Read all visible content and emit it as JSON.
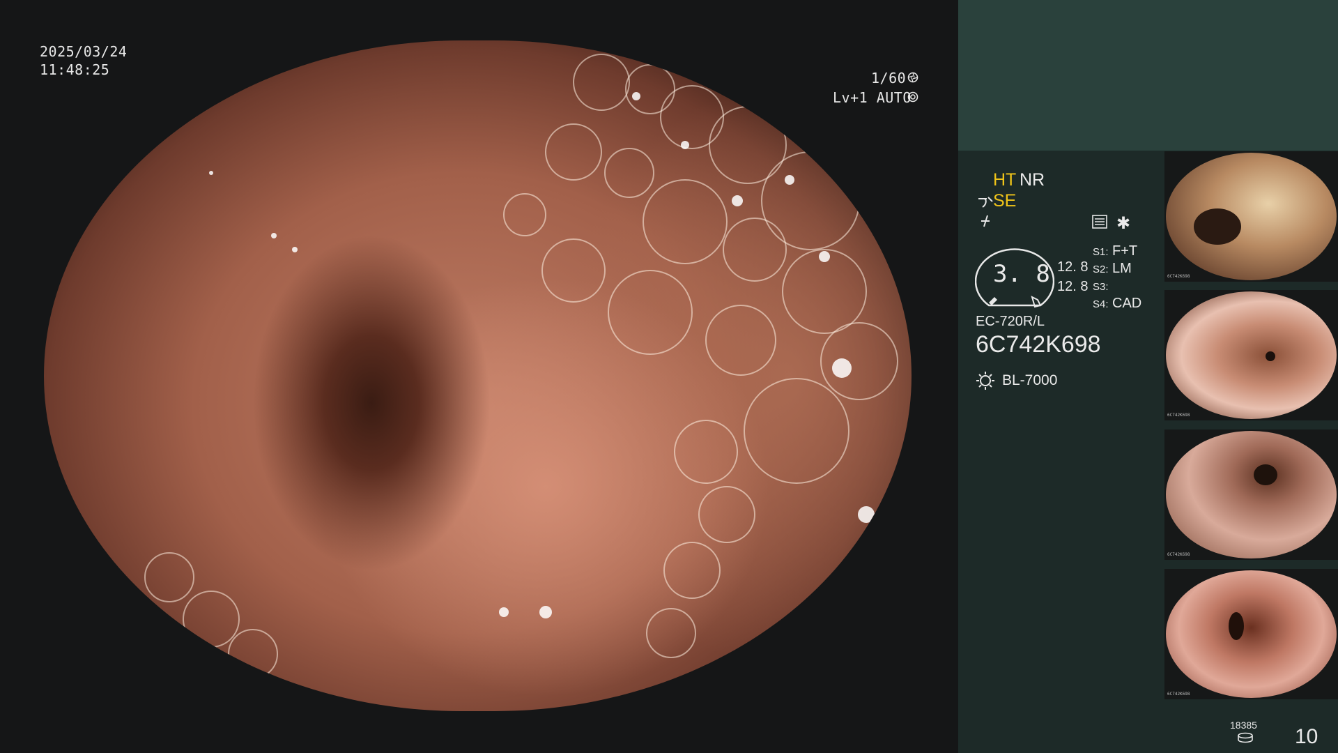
{
  "video": {
    "date": "2025/03/24",
    "time": "11:48:25",
    "shutter": "1/60",
    "level_auto": "Lv+1 AUTO"
  },
  "panel": {
    "ht": "HT",
    "nr": "NR",
    "se": "SE",
    "zoom_value": "3. 8",
    "val1": "12. 8",
    "val2": "12. 8",
    "s1_key": "S1:",
    "s1_val": "F+T",
    "s2_key": "S2:",
    "s2_val": "LM",
    "s3_key": "S3:",
    "s3_val": "",
    "s4_key": "S4:",
    "s4_val": "CAD",
    "scope_model": "EC-720R/L",
    "scope_serial": "6C742K698",
    "light_source": "BL-7000",
    "storage_count": "18385",
    "image_count": "10"
  },
  "icons": [
    "shutter-icon",
    "auto-iris-icon",
    "scope-icon",
    "function-icon",
    "menu-icon",
    "asterisk-icon",
    "light-source-icon",
    "storage-icon"
  ],
  "thumbnails": [
    {
      "label": "6C742K698",
      "color": "#9a6a44"
    },
    {
      "label": "6C742K698",
      "color": "#c88c74"
    },
    {
      "label": "6C742K698",
      "color": "#c79482"
    },
    {
      "label": "6C742K698",
      "color": "#bf7864"
    }
  ]
}
